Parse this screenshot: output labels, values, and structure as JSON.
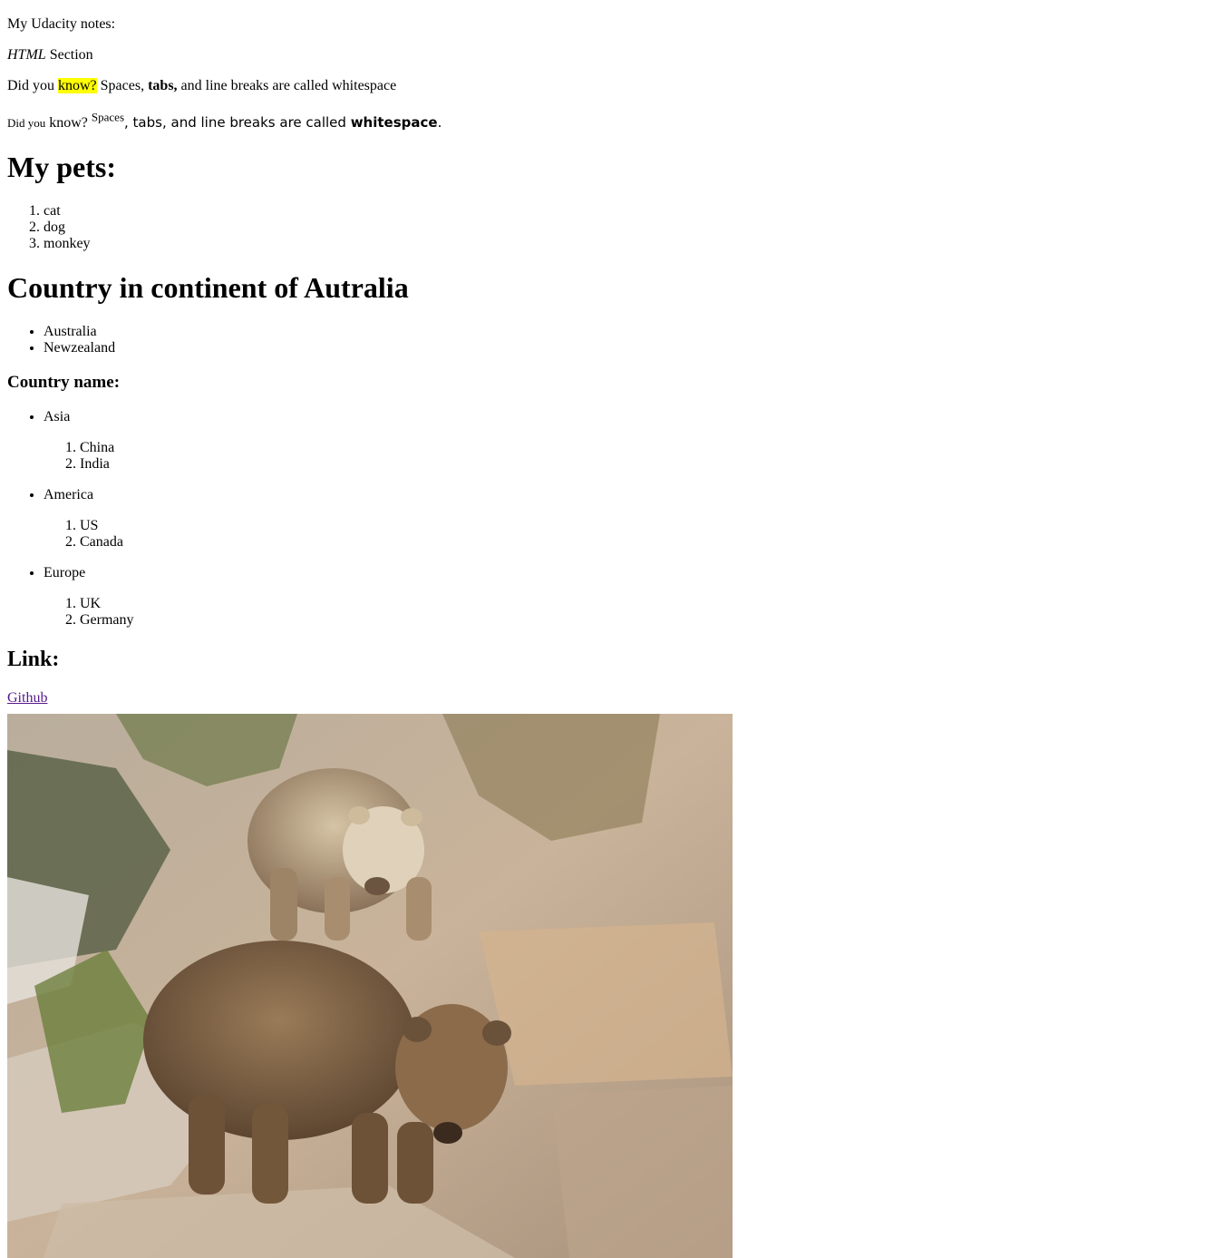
{
  "notes_title": "My Udacity notes:",
  "section": {
    "em": "HTML",
    "rest": " Section"
  },
  "dyk1": {
    "a": "Did you ",
    "mark": "know?",
    "b": " Spaces, ",
    "bold": "tabs,",
    "c": " and line breaks are called whitespace"
  },
  "dyk2": {
    "small": "Did you",
    "a": " know? ",
    "sup": "Spaces",
    "b": ", tabs, and line breaks are called ",
    "bold": "whitespace",
    "c": "."
  },
  "pets": {
    "heading": "My pets:",
    "items": [
      "cat",
      "dog",
      "monkey"
    ]
  },
  "continent": {
    "heading": "Country in continent of Autralia",
    "items": [
      "Australia",
      "Newzealand"
    ]
  },
  "country_names": {
    "heading": "Country name:",
    "groups": [
      {
        "name": "Asia",
        "items": [
          "China",
          "India"
        ]
      },
      {
        "name": "America",
        "items": [
          "US",
          "Canada"
        ]
      },
      {
        "name": "Europe",
        "items": [
          "UK",
          "Germany"
        ]
      }
    ]
  },
  "link_section": {
    "heading": "Link:",
    "link_text": "Github"
  },
  "colors": {
    "link": "#551a8b",
    "highlight": "#ffff00"
  },
  "image": {
    "subject": "two brown bears on rocks"
  }
}
